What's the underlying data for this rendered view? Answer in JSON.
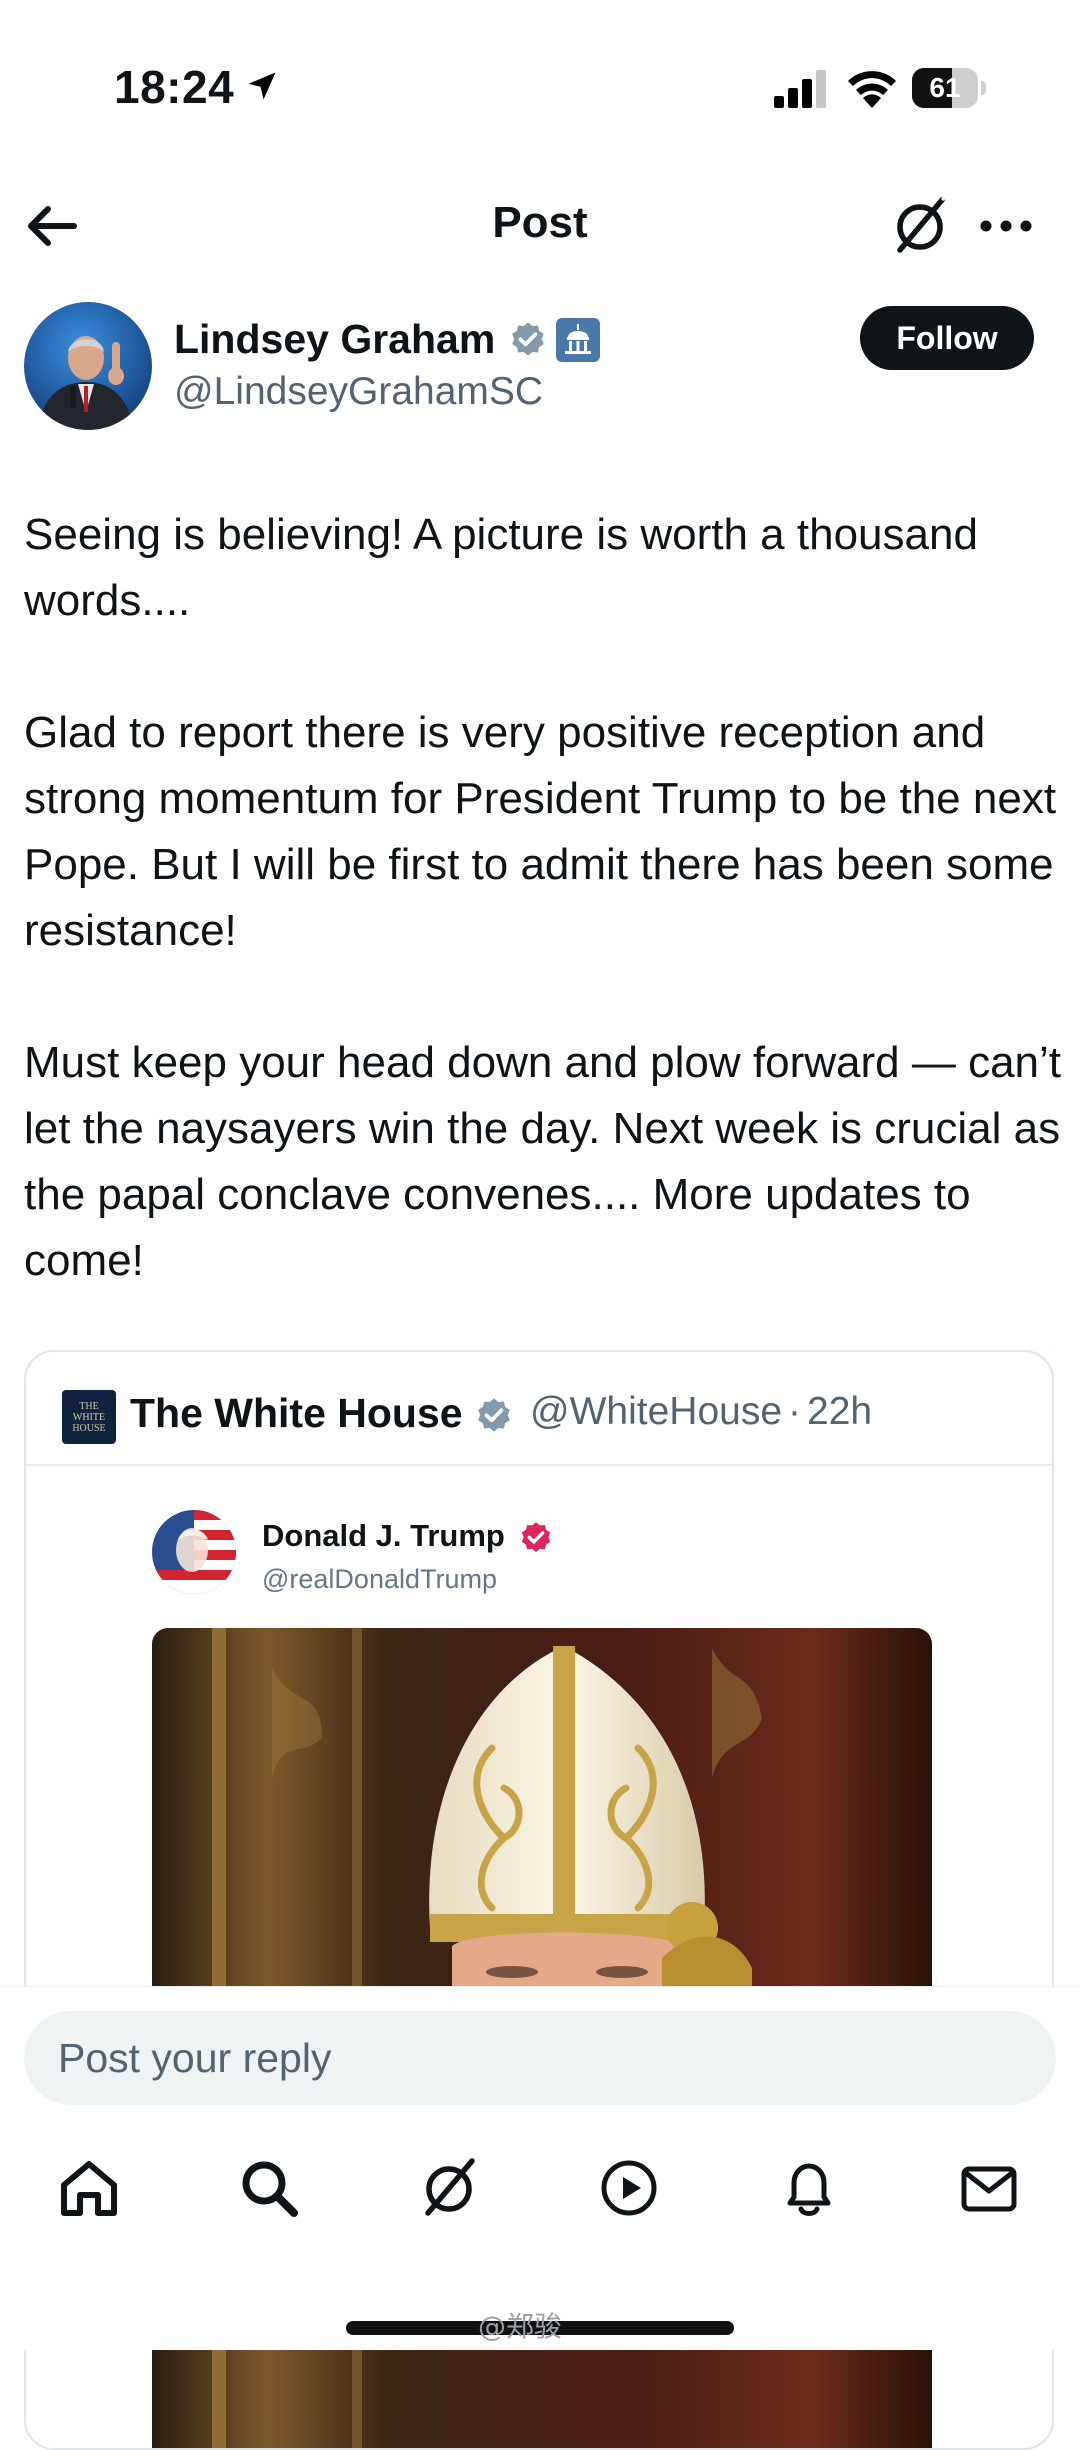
{
  "status_bar": {
    "time": "18:24",
    "battery": "61",
    "battery_level": 0.61,
    "icons": [
      "location-arrow-icon",
      "cellular-signal-icon",
      "wifi-icon",
      "battery-icon"
    ]
  },
  "header": {
    "title": "Post",
    "icons": [
      "back-arrow-icon",
      "grok-icon",
      "more-icon"
    ]
  },
  "author": {
    "name": "Lindsey Graham",
    "handle": "@LindseyGrahamSC",
    "follow_label": "Follow",
    "badges": [
      "verified-gray-icon",
      "government-badge-icon"
    ]
  },
  "post": {
    "paragraphs": [
      "Seeing is believing! A picture is worth a thousand words....",
      "Glad to report there is very positive reception and strong momentum for President Trump to be the next Pope. But I will be first to admit there has been some resistance!",
      "Must keep your head down and plow forward — can’t let the naysayers win the day. Next week is crucial as the papal conclave convenes.... More updates to come!"
    ]
  },
  "quote": {
    "name": "The White House",
    "handle": "@WhiteHouse",
    "separator": "·",
    "time": "22h",
    "logo_text": "THE WHITE HOUSE",
    "inner": {
      "name": "Donald J. Trump",
      "handle": "@realDonaldTrump"
    }
  },
  "reply": {
    "placeholder": "Post your reply"
  },
  "tab_bar": {
    "items": [
      "home",
      "search",
      "grok",
      "video",
      "notifications",
      "messages"
    ]
  },
  "watermark": "@郑骏",
  "colors": {
    "text": "#0f1419",
    "secondary": "#536471",
    "follow_bg": "#0f1419",
    "verified_gray": "#829aab",
    "pink_badge": "#e0245e",
    "input_bg": "#eff3f4"
  }
}
